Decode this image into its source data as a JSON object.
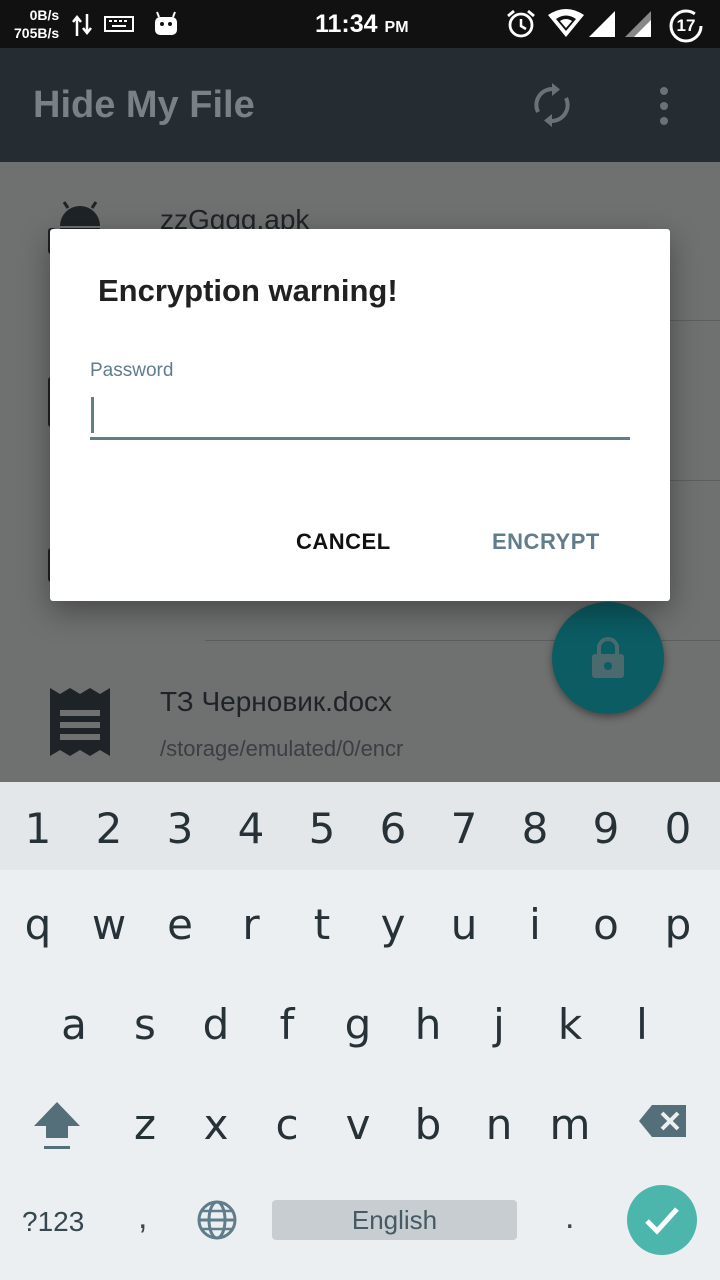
{
  "status_bar": {
    "net_up": "0B/s",
    "net_down": "705B/s",
    "time": "11:34",
    "ampm": "PM",
    "battery": "17",
    "icons": [
      "transfer-icon",
      "keyboard-icon",
      "android-debug-icon",
      "alarm-icon",
      "wifi-icon",
      "signal-icon",
      "signal-icon",
      "battery-icon"
    ]
  },
  "app_bar": {
    "title": "Hide My File",
    "actions": [
      "sync-icon",
      "more-vert-icon"
    ]
  },
  "file_list": {
    "items": [
      {
        "title": "zzGggg.apk",
        "subtitle": "",
        "icon": "android-icon"
      },
      {
        "title": "",
        "subtitle": "",
        "icon": "file-icon"
      },
      {
        "title": "",
        "subtitle": "",
        "icon": "file-icon"
      },
      {
        "title": "ТЗ Черновик.docx",
        "subtitle": "/storage/emulated/0/encr",
        "icon": "document-icon"
      }
    ]
  },
  "fab": {
    "icon": "lock-icon",
    "color": "#00838f"
  },
  "dialog": {
    "title": "Encryption warning!",
    "field_label": "Password",
    "field_value": "",
    "cancel_label": "CANCEL",
    "encrypt_label": "ENCRYPT"
  },
  "keyboard": {
    "number_row": [
      "1",
      "2",
      "3",
      "4",
      "5",
      "6",
      "7",
      "8",
      "9",
      "0"
    ],
    "row1": [
      "q",
      "w",
      "e",
      "r",
      "t",
      "y",
      "u",
      "i",
      "o",
      "p"
    ],
    "row2": [
      "a",
      "s",
      "d",
      "f",
      "g",
      "h",
      "j",
      "k",
      "l"
    ],
    "row3": [
      "z",
      "x",
      "c",
      "v",
      "b",
      "n",
      "m"
    ],
    "symbols_label": "?123",
    "comma": ",",
    "period": ".",
    "space_label": "English",
    "accent_color": "#4db6ac"
  }
}
